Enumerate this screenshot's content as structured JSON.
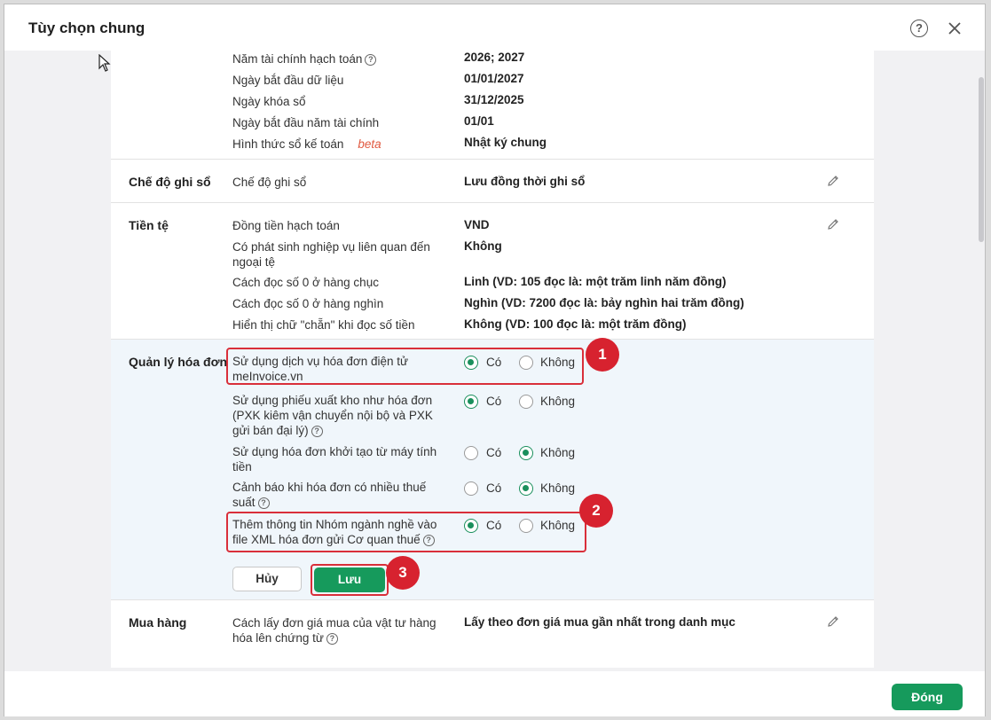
{
  "dialog": {
    "title": "Tùy chọn chung",
    "help_icon": "?",
    "close_icon_name": "close-icon"
  },
  "fiscal": {
    "rows": [
      {
        "label": "Năm tài chính hạch toán",
        "value": "2026; 2027"
      },
      {
        "label": "Ngày bắt đầu dữ liệu",
        "value": "01/01/2027"
      },
      {
        "label": "Ngày khóa sổ",
        "value": "31/12/2025"
      },
      {
        "label": "Ngày bắt đầu năm tài chính",
        "value": "01/01"
      },
      {
        "label": "Hình thức sổ kế toán",
        "value": "Nhật ký chung",
        "tag": "beta"
      }
    ]
  },
  "che_do": {
    "title": "Chế độ ghi sổ",
    "label": "Chế độ ghi sổ",
    "value": "Lưu đồng thời ghi sổ"
  },
  "tien_te": {
    "title": "Tiền tệ",
    "rows": [
      {
        "label": "Đồng tiền hạch toán",
        "value": "VND"
      },
      {
        "label": "Có phát sinh nghiệp vụ liên quan đến ngoại tệ",
        "value": "Không"
      },
      {
        "label": "Cách đọc số 0 ở hàng chục",
        "value": "Linh (VD: 105 đọc là: một trăm linh năm đồng)"
      },
      {
        "label": "Cách đọc số 0 ở hàng nghìn",
        "value": "Nghìn (VD: 7200 đọc là: bảy nghìn hai trăm đồng)"
      },
      {
        "label": "Hiển thị chữ \"chẵn\" khi đọc số tiền",
        "value": "Không (VD: 100 đọc là: một trăm đồng)"
      }
    ]
  },
  "hoa_don": {
    "title": "Quản lý hóa đơn",
    "yes": "Có",
    "no": "Không",
    "rows": [
      {
        "label": "Sử dụng dịch vụ hóa đơn điện tử meInvoice.vn",
        "selected": "yes"
      },
      {
        "label": "Sử dụng phiếu xuất kho như hóa đơn (PXK kiêm vận chuyển nội bộ và PXK gửi bán đại lý)",
        "selected": "yes"
      },
      {
        "label": "Sử dụng hóa đơn khởi tạo từ máy tính tiền",
        "selected": "no"
      },
      {
        "label": "Cảnh báo khi hóa đơn có nhiều thuế suất",
        "selected": "no"
      },
      {
        "label": "Thêm thông tin Nhóm ngành nghề vào file XML hóa đơn gửi Cơ quan thuế",
        "selected": "yes"
      }
    ],
    "cancel_label": "Hủy",
    "save_label": "Lưu"
  },
  "mua_hang": {
    "title": "Mua hàng",
    "label": "Cách lấy đơn giá mua của vật tư hàng hóa lên chứng từ",
    "value": "Lấy theo đơn giá mua gần nhất trong danh mục"
  },
  "badges": [
    "1",
    "2",
    "3"
  ],
  "footer": {
    "close_label": "Đóng"
  },
  "colors": {
    "accent": "#169a5c",
    "highlight": "#d92f3a",
    "section_bg": "#f0f6fb"
  }
}
